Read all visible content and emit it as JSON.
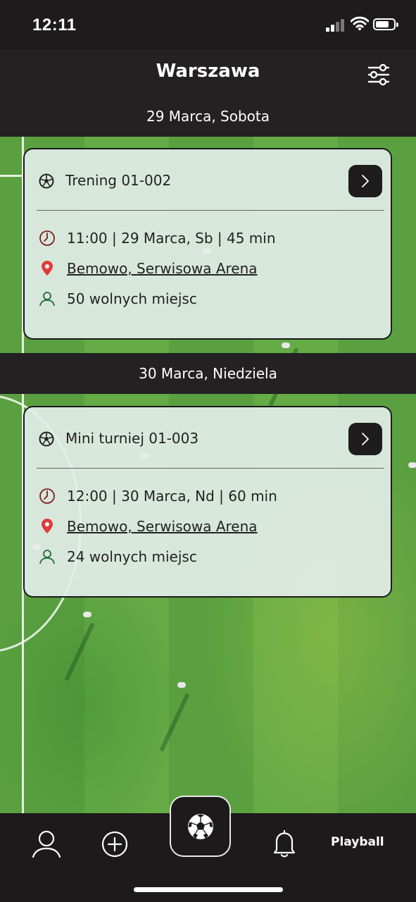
{
  "status_bar": {
    "time": "12:11"
  },
  "header": {
    "city": "Warszawa",
    "filter_icon": "sliders-icon"
  },
  "events": [
    {
      "date_label": "29 Marca, Sobota",
      "title": "Trening 01-002",
      "time_line": "11:00 |  29 Marca, Sb |  45 min",
      "location": "Bemowo, Serwisowa Arena",
      "spots": "50 wolnych miejsc"
    },
    {
      "date_label": "30 Marca, Niedziela",
      "title": "Mini turniej 01-003",
      "time_line": "12:00 |  30 Marca, Nd |  60 min",
      "location": "Bemowo, Serwisowa Arena",
      "spots": "24 wolnych miejsc"
    }
  ],
  "tab_bar": {
    "items": [
      "profile-icon",
      "add-icon",
      "soccer-ball-icon",
      "bell-icon"
    ],
    "brand": "Playball"
  },
  "colors": {
    "dark": "#1c1a1b",
    "card": "#e6eeec",
    "pin": "#e03b3b",
    "clock": "#7a2020",
    "user": "#1f6b3a"
  }
}
